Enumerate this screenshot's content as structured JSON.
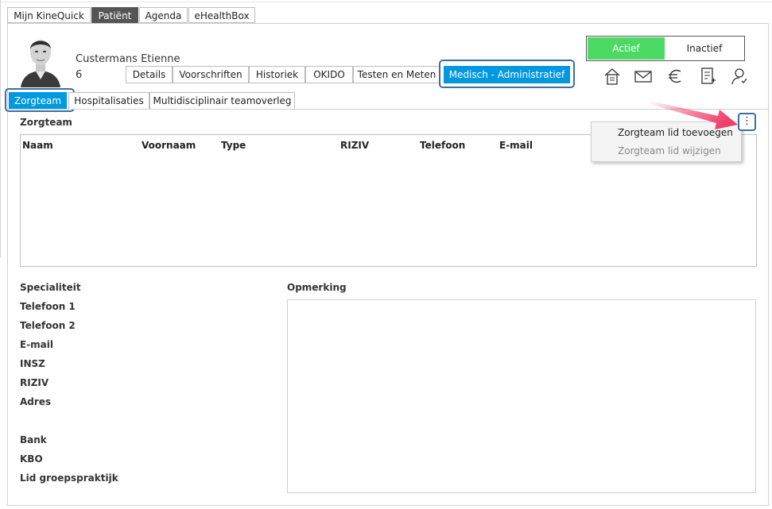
{
  "top_tabs": [
    {
      "label": "Mijn KineQuick"
    },
    {
      "label": "Patiënt"
    },
    {
      "label": "Agenda"
    },
    {
      "label": "eHealthBox"
    }
  ],
  "patient": {
    "name": "Custermans Etienne",
    "number": "6"
  },
  "patient_tabs": [
    {
      "label": "Details"
    },
    {
      "label": "Voorschriften"
    },
    {
      "label": "Historiek"
    },
    {
      "label": "OKIDO"
    },
    {
      "label": "Testen en Meten"
    },
    {
      "label": "Medisch - Administratief"
    }
  ],
  "status": {
    "active": "Actief",
    "inactive": "Inactief",
    "active_color": "#4cd964"
  },
  "toolbar_icons": [
    "house-document-icon",
    "mail-icon",
    "euro-icon",
    "document-icon",
    "user-icon"
  ],
  "admin_tabs": [
    {
      "label": "Zorgteam"
    },
    {
      "label": "Hospitalisaties"
    },
    {
      "label": "Multidisciplinair teamoverleg"
    }
  ],
  "zorgteam": {
    "title": "Zorgteam",
    "columns": [
      "Naam",
      "Voornaam",
      "Type",
      "RIZIV",
      "Telefoon",
      "E-mail"
    ],
    "menu_button": "⋮",
    "menu": {
      "add": "Zorgteam lid toevoegen",
      "edit": "Zorgteam lid wijzigen"
    }
  },
  "details": {
    "labels": [
      "Specialiteit",
      "Telefoon 1",
      "Telefoon 2",
      "E-mail",
      "INSZ",
      "RIZIV",
      "Adres",
      "Bank",
      "KBO",
      "Lid groepspraktijk"
    ],
    "remark_title": "Opmerking"
  },
  "colors": {
    "accent": "#0098e0",
    "focus": "#3a6ea8",
    "arrow": "#ef3f6b"
  }
}
